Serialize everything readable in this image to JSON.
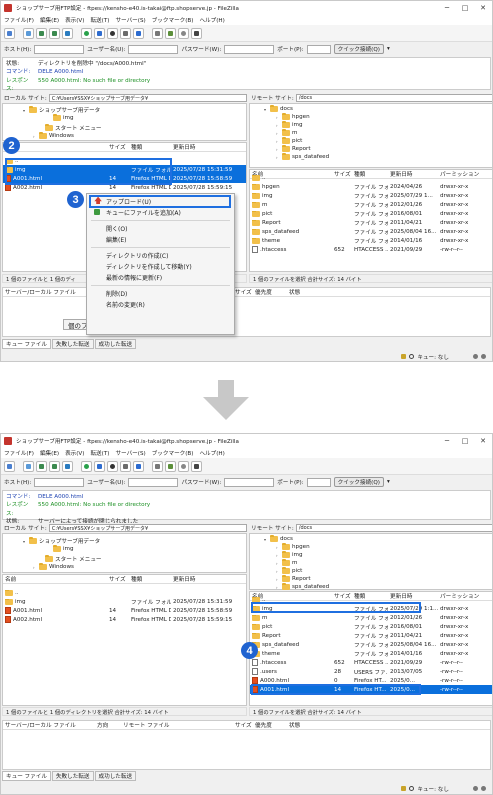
{
  "title": "ショップサーブ用FTP設定 - ftpes://kensho-e40.is-takai@ftp.shopserve.jp - FileZilla",
  "menu": [
    "ファイル(F)",
    "編集(E)",
    "表示(V)",
    "転送(T)",
    "サーバー(S)",
    "ブックマーク(B)",
    "ヘルプ(H)"
  ],
  "conn": {
    "host": "ホスト(H):",
    "user": "ユーザー名(U):",
    "pass": "パスワード(W):",
    "port": "ポート(P):",
    "quick": "クイック接続(Q)"
  },
  "log1": [
    {
      "label": "状態:",
      "text": "ディレクトリを削除中 \"/docs/A000.html\"",
      "color": "#222"
    },
    {
      "label": "コマンド:",
      "text": "DELE A000.html",
      "color": "#1a3fb0"
    },
    {
      "label": "レスポンス:",
      "text": "550 A000.html: No such file or directory",
      "color": "#1a8f22"
    }
  ],
  "log2": [
    {
      "label": "コマンド:",
      "text": "DELE A000.html",
      "color": "#1a3fb0"
    },
    {
      "label": "レスポンス:",
      "text": "550 A000.html: No such file or directory",
      "color": "#1a8f22"
    },
    {
      "label": "状態:",
      "text": "サーバーによって接続が閉じられました",
      "color": "#222"
    }
  ],
  "local_site_label": "ローカル サイト:",
  "local_path": "C:¥Users¥SSX¥ショップサーブ用データ¥",
  "remote_site_label": "リモート サイト:",
  "remote_path": "/docs",
  "local_tree": [
    "ショップサーブ用データ",
    "img",
    "スタート メニュー",
    "Windows"
  ],
  "remote_tree": [
    "docs",
    "hpgen",
    "img",
    "m",
    "pict",
    "Report",
    "sps_datafeed"
  ],
  "local_cols": [
    "名前",
    "サイズ",
    "種類",
    "更新日時"
  ],
  "remote_cols": [
    "名前",
    "サイズ",
    "種類",
    "更新日時",
    "パーミッション"
  ],
  "local_files": [
    {
      "name": "..",
      "size": "",
      "type": "",
      "date": ""
    },
    {
      "name": "img",
      "size": "",
      "type": "ファイル フォルダー",
      "date": "2025/07/28 15:31:59"
    },
    {
      "name": "A001.html",
      "size": "14",
      "type": "Firefox HTML Doc...",
      "date": "2025/07/28 15:58:59"
    },
    {
      "name": "A002.html",
      "size": "14",
      "type": "Firefox HTML Doc...",
      "date": "2025/07/28 15:59:15"
    }
  ],
  "remote_files_1": [
    {
      "name": "..",
      "size": "",
      "type": "",
      "date": "",
      "perm": ""
    },
    {
      "name": "hpgen",
      "size": "",
      "type": "ファイル フォ...",
      "date": "2024/04/26",
      "perm": "drwxr-xr-x"
    },
    {
      "name": "img",
      "size": "",
      "type": "ファイル フォ...",
      "date": "2025/07/29 1...",
      "perm": "drwxr-xr-x"
    },
    {
      "name": "m",
      "size": "",
      "type": "ファイル フォ...",
      "date": "2012/01/26",
      "perm": "drwxr-xr-x"
    },
    {
      "name": "pict",
      "size": "",
      "type": "ファイル フォ...",
      "date": "2016/08/01",
      "perm": "drwxr-xr-x"
    },
    {
      "name": "Report",
      "size": "",
      "type": "ファイル フォ...",
      "date": "2011/04/21",
      "perm": "drwxr-xr-x"
    },
    {
      "name": "sps_datafeed",
      "size": "",
      "type": "ファイル フォ...",
      "date": "2025/08/04 16...",
      "perm": "drwxr-xr-x"
    },
    {
      "name": "theme",
      "size": "",
      "type": "ファイル フォ...",
      "date": "2014/01/16",
      "perm": "drwxr-xr-x"
    },
    {
      "name": ".htaccess",
      "size": "652",
      "type": "HTACCESS ...",
      "date": "2021/09/29",
      "perm": "-rw-r--r--"
    }
  ],
  "remote_files_2": [
    {
      "name": "..",
      "size": "",
      "type": "",
      "date": "",
      "perm": ""
    },
    {
      "name": "img",
      "size": "",
      "type": "ファイル フォ...",
      "date": "2025/07/29 1:1...",
      "perm": "drwxr-xr-x"
    },
    {
      "name": "m",
      "size": "",
      "type": "ファイル フォ...",
      "date": "2012/01/26",
      "perm": "drwxr-xr-x"
    },
    {
      "name": "pict",
      "size": "",
      "type": "ファイル フォ...",
      "date": "2016/08/01",
      "perm": "drwxr-xr-x"
    },
    {
      "name": "Report",
      "size": "",
      "type": "ファイル フォ...",
      "date": "2011/04/21",
      "perm": "drwxr-xr-x"
    },
    {
      "name": "sps_datafeed",
      "size": "",
      "type": "ファイル フォ...",
      "date": "2025/08/04 16...",
      "perm": "drwxr-xr-x"
    },
    {
      "name": "theme",
      "size": "",
      "type": "ファイル フォ...",
      "date": "2014/01/16",
      "perm": "drwxr-xr-x"
    },
    {
      "name": ".htaccess",
      "size": "652",
      "type": "HTACCESS ...",
      "date": "2021/09/29",
      "perm": "-rw-r--r--"
    },
    {
      "name": ".users",
      "size": "28",
      "type": "USERS ファ...",
      "date": "2013/07/05",
      "perm": "-rw-r--r--"
    },
    {
      "name": "A000.html",
      "size": "0",
      "type": "Firefox HT...",
      "date": "2025/0...",
      "perm": "-rw-r--r--"
    },
    {
      "name": "A001.html",
      "size": "14",
      "type": "Firefox HT...",
      "date": "2025/0...",
      "perm": "-rw-r--r--"
    }
  ],
  "local_status": "1 個のファイルと 1 個のディレクトリを選択 合計サイズ: 14 バイト",
  "local_status_1": "1 個のファイルと 1 個のディ",
  "remote_status": "1 個のファイルを選択 合計サイズ: 14 バイト",
  "queue_cols": [
    "サーバー/ローカル ファイル",
    "方向",
    "リモート ファイル",
    "サイズ",
    "優先度",
    "状態"
  ],
  "queue_tabs": [
    "キュー ファイル",
    "失敗した転送",
    "成功した転送"
  ],
  "queue_status": "キュー: なし",
  "queue_popup": "個のファ",
  "context_menu": [
    "アップロード(U)",
    "キューにファイルを追加(A)",
    "開く(O)",
    "編集(E)",
    "ディレクトリの作成(C)",
    "ディレクトリを作成して移動(Y)",
    "最新の情報に更新(F)",
    "削除(D)",
    "名前の変更(R)"
  ],
  "badges": [
    "2",
    "3",
    "4"
  ],
  "colors": {
    "accent": "#1f63d0",
    "selection": "#0a6fdc",
    "folder": "#f2c04a",
    "upload_arrow": "#d23b2c"
  }
}
